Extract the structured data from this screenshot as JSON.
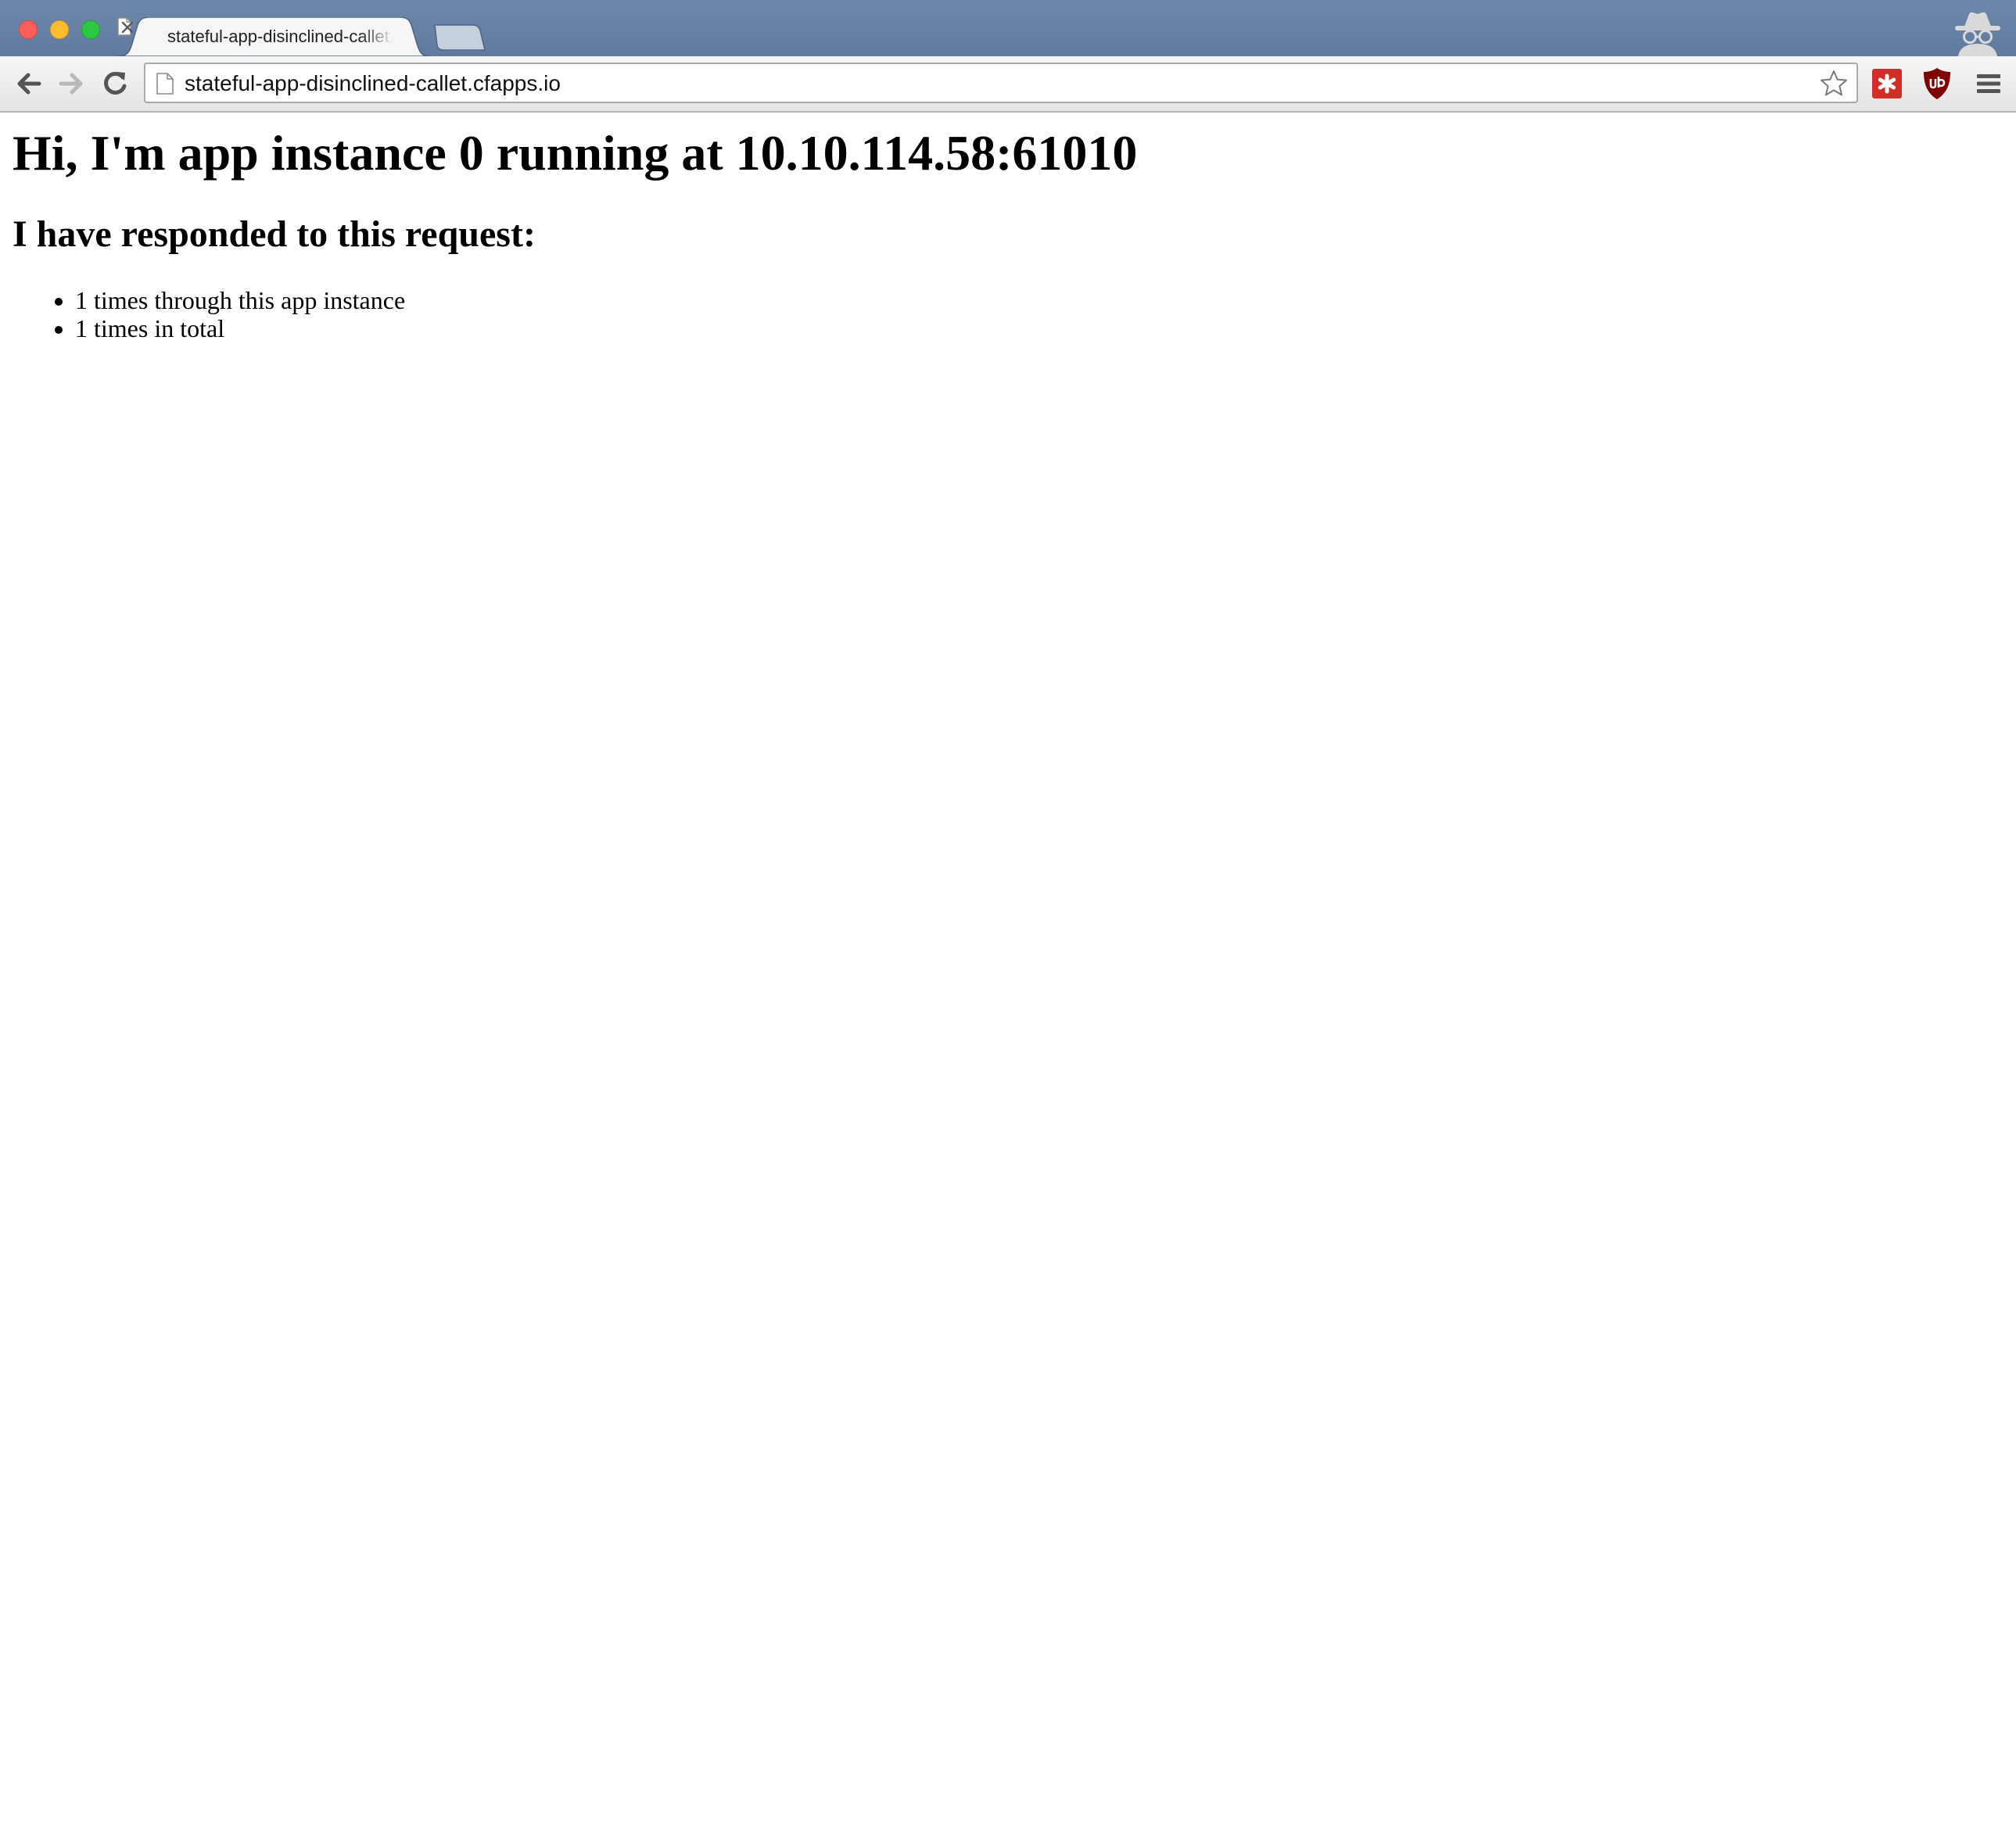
{
  "browser": {
    "tab": {
      "title": "stateful-app-disinclined-callet.cfapps.io"
    },
    "address_bar": {
      "url": "stateful-app-disinclined-callet.cfapps.io"
    },
    "icons": {
      "back": "back-arrow-icon",
      "forward": "forward-arrow-icon",
      "reload": "reload-icon",
      "bookmark": "star-icon",
      "extension_1": "lastpass-icon",
      "extension_2": "ublock-origin-icon",
      "menu": "hamburger-menu-icon",
      "profile": "incognito-icon"
    },
    "colors": {
      "titlebar": "#6e88ab",
      "close": "#fc5f57",
      "minimize": "#fdbc2e",
      "maximize": "#2ac940",
      "lastpass": "#d32d27",
      "ublock": "#800000"
    }
  },
  "page": {
    "heading": "Hi, I'm app instance 0 running at 10.10.114.58:61010",
    "subheading": "I have responded to this request:",
    "stats": [
      "1 times through this app instance",
      "1 times in total"
    ]
  }
}
